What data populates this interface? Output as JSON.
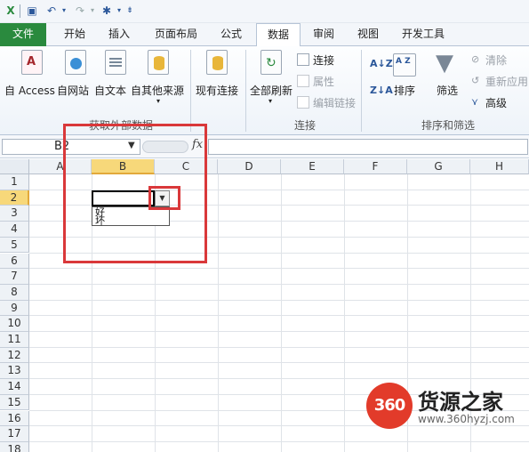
{
  "tabs": [
    "文件",
    "开始",
    "插入",
    "页面布局",
    "公式",
    "数据",
    "审阅",
    "视图",
    "开发工具"
  ],
  "active_tab": "数据",
  "ribbon": {
    "get_external": {
      "buttons": [
        "自 Access",
        "自网站",
        "自文本",
        "自其他来源"
      ],
      "group_label": "获取外部数据"
    },
    "existing_conn": "现有连接",
    "connections": {
      "refresh_all": "全部刷新",
      "connect": "连接",
      "properties": "属性",
      "edit_links": "编辑链接",
      "group_label": "连接"
    },
    "sort_filter": {
      "sort": "排序",
      "filter": "筛选",
      "clear": "清除",
      "reapply": "重新应用",
      "advanced": "高级",
      "group_label": "排序和筛选"
    }
  },
  "formula_bar": {
    "name_box": "B2",
    "fx": "fx",
    "formula": ""
  },
  "columns": [
    "A",
    "B",
    "C",
    "D",
    "E",
    "F",
    "G",
    "H"
  ],
  "selected_column": "B",
  "rows": [
    "1",
    "2",
    "3",
    "4",
    "5",
    "6",
    "7",
    "8",
    "9",
    "10",
    "11",
    "12",
    "13",
    "14",
    "15",
    "16",
    "17",
    "18"
  ],
  "selected_row": "2",
  "dropdown": {
    "options": [
      "好",
      "坏"
    ]
  },
  "watermark": {
    "logo": "360",
    "text": "货源之家",
    "url": "www.360hyzj.com"
  },
  "colors": {
    "file_tab": "#2a8a3e",
    "highlight": "#d9383a",
    "selected_header": "#f7d87a"
  }
}
